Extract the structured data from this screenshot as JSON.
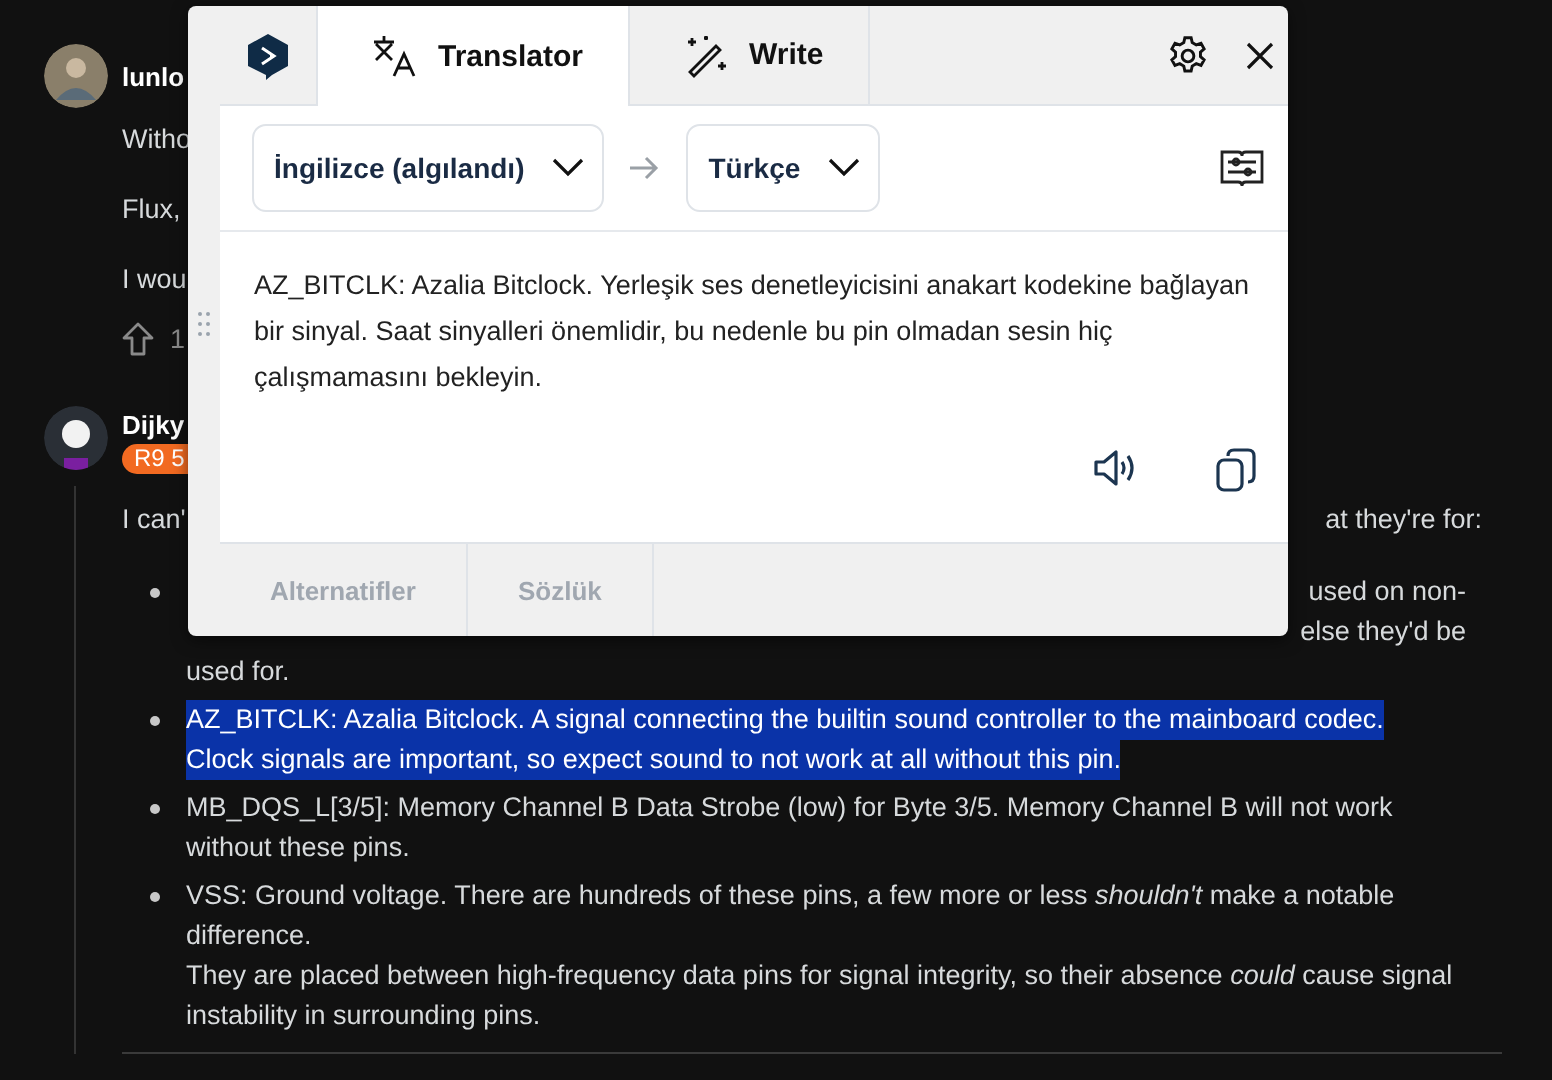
{
  "thread": {
    "comments": [
      {
        "username": "lunlo",
        "paragraphs": [
          "Witho",
          "Flux,",
          "I wou"
        ],
        "vote_count": "1"
      },
      {
        "username": "Dijky",
        "flair": "R9 5",
        "intro": {
          "left": "I can'",
          "right": "at they're for:"
        },
        "bullets": [
          {
            "selected": false,
            "right_lines": [
              "used on non-",
              "else they'd be"
            ],
            "lines": [
              "used for."
            ]
          },
          {
            "selected": true,
            "lines": [
              "AZ_BITCLK: Azalia Bitclock. A signal connecting the builtin sound controller to the mainboard codec.",
              "Clock signals are important, so expect sound to not work at all without this pin."
            ]
          },
          {
            "selected": false,
            "lines": [
              "MB_DQS_L[3/5]: Memory Channel B Data Strobe (low) for Byte 3/5. Memory Channel B will not work",
              "without these pins."
            ]
          },
          {
            "selected": false,
            "lines": [
              "VSS: Ground voltage. There are hundreds of these pins, a few more or less *shouldn't* make a notable",
              "difference.",
              "They are placed between high-frequency data pins for signal integrity, so their absence *could* cause signal",
              "instability in surrounding pins."
            ]
          }
        ]
      }
    ]
  },
  "translator": {
    "tabs": [
      {
        "label": "Translator",
        "kind": "translate",
        "selected": true
      },
      {
        "label": "Write",
        "kind": "write",
        "selected": false
      }
    ],
    "source_language": "İngilizce (algılandı)",
    "target_language": "Türkçe",
    "translation": "AZ_BITCLK: Azalia Bitclock. Yerleşik ses denetleyicisini anakart kodekine bağlayan bir sinyal. Saat sinyalleri önemlidir, bu nedenle bu pin olmadan sesin hiç çalışmamasını bekleyin.",
    "bottom_tabs": [
      {
        "label": "Alternatifler",
        "disabled": true
      },
      {
        "label": "Sözlük",
        "disabled": true
      }
    ]
  }
}
